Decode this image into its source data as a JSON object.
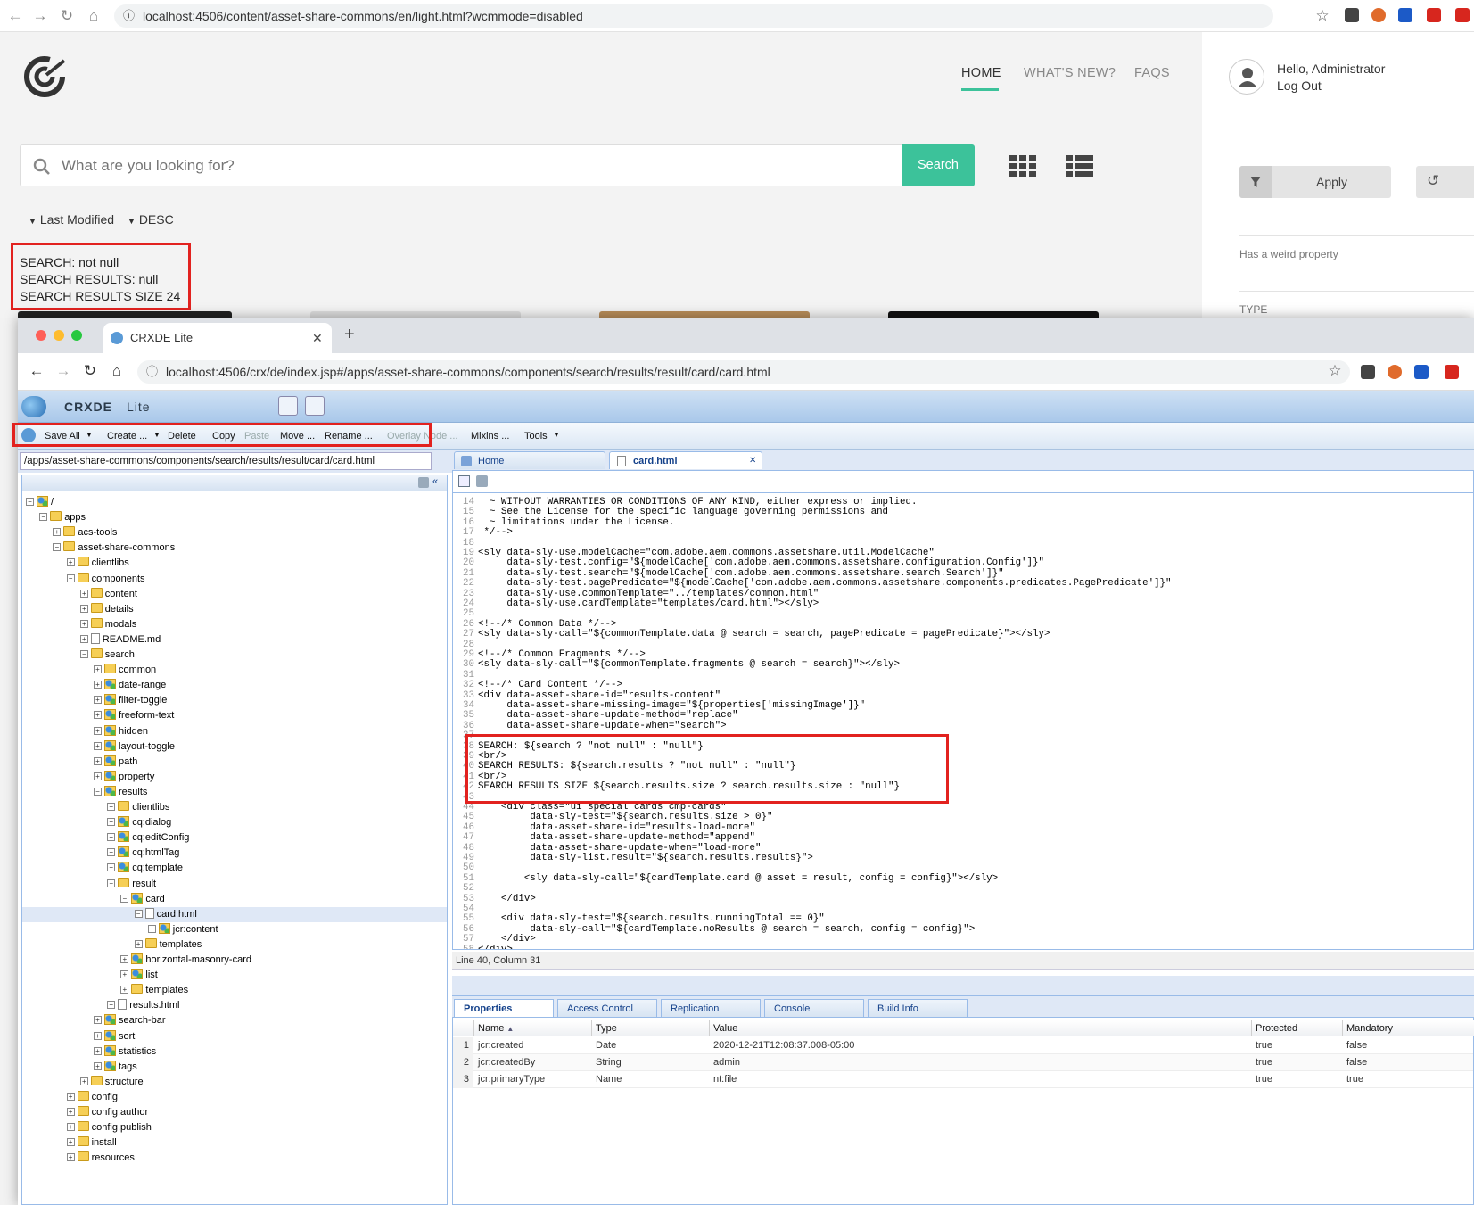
{
  "back_browser": {
    "url": "localhost:4506/content/asset-share-commons/en/light.html?wcmmode=disabled"
  },
  "asset_page": {
    "nav": [
      "HOME",
      "WHAT'S NEW?",
      "FAQS"
    ],
    "user_greeting": "Hello, Administrator",
    "logout": "Log Out",
    "search_placeholder": "What are you looking for?",
    "search_button": "Search",
    "apply_button": "Apply",
    "sort_field": "Last Modified",
    "sort_order": "DESC",
    "filter_label": "Has a weird property",
    "type_label": "TYPE",
    "debug_lines": [
      "SEARCH: not null",
      "SEARCH RESULTS: null",
      "SEARCH RESULTS SIZE 24"
    ]
  },
  "front_browser": {
    "tab_title": "CRXDE Lite",
    "url": "localhost:4506/crx/de/index.jsp#/apps/asset-share-commons/components/search/results/result/card/card.html"
  },
  "crxde": {
    "logo_main": "CRXDE",
    "logo_sub": "Lite",
    "toolbar": [
      "Save All",
      "Create ...",
      "Delete",
      "Copy",
      "Paste",
      "Move ...",
      "Rename ...",
      "Overlay Node ...",
      "Mixins ...",
      "Tools"
    ],
    "path": "/apps/asset-share-commons/components/search/results/result/card/card.html",
    "tree": [
      {
        "label": "/",
        "depth": 0,
        "icon": "comp",
        "open": true
      },
      {
        "label": "apps",
        "depth": 1,
        "icon": "folder",
        "open": true
      },
      {
        "label": "acs-tools",
        "depth": 2,
        "icon": "folder"
      },
      {
        "label": "asset-share-commons",
        "depth": 2,
        "icon": "folder",
        "open": true
      },
      {
        "label": "clientlibs",
        "depth": 3,
        "icon": "folder"
      },
      {
        "label": "components",
        "depth": 3,
        "icon": "folder",
        "open": true
      },
      {
        "label": "content",
        "depth": 4,
        "icon": "folder"
      },
      {
        "label": "details",
        "depth": 4,
        "icon": "folder"
      },
      {
        "label": "modals",
        "depth": 4,
        "icon": "folder"
      },
      {
        "label": "README.md",
        "depth": 4,
        "icon": "file"
      },
      {
        "label": "search",
        "depth": 4,
        "icon": "folder",
        "open": true
      },
      {
        "label": "common",
        "depth": 5,
        "icon": "folder"
      },
      {
        "label": "date-range",
        "depth": 5,
        "icon": "comp"
      },
      {
        "label": "filter-toggle",
        "depth": 5,
        "icon": "comp"
      },
      {
        "label": "freeform-text",
        "depth": 5,
        "icon": "comp"
      },
      {
        "label": "hidden",
        "depth": 5,
        "icon": "comp"
      },
      {
        "label": "layout-toggle",
        "depth": 5,
        "icon": "comp"
      },
      {
        "label": "path",
        "depth": 5,
        "icon": "comp"
      },
      {
        "label": "property",
        "depth": 5,
        "icon": "comp"
      },
      {
        "label": "results",
        "depth": 5,
        "icon": "comp",
        "open": true
      },
      {
        "label": "clientlibs",
        "depth": 6,
        "icon": "folder"
      },
      {
        "label": "cq:dialog",
        "depth": 6,
        "icon": "comp"
      },
      {
        "label": "cq:editConfig",
        "depth": 6,
        "icon": "comp"
      },
      {
        "label": "cq:htmlTag",
        "depth": 6,
        "icon": "comp"
      },
      {
        "label": "cq:template",
        "depth": 6,
        "icon": "comp"
      },
      {
        "label": "result",
        "depth": 6,
        "icon": "folder",
        "open": true
      },
      {
        "label": "card",
        "depth": 7,
        "icon": "comp",
        "open": true
      },
      {
        "label": "card.html",
        "depth": 8,
        "icon": "file",
        "open": true,
        "selected": true
      },
      {
        "label": "jcr:content",
        "depth": 9,
        "icon": "comp"
      },
      {
        "label": "templates",
        "depth": 8,
        "icon": "folder"
      },
      {
        "label": "horizontal-masonry-card",
        "depth": 7,
        "icon": "comp"
      },
      {
        "label": "list",
        "depth": 7,
        "icon": "comp"
      },
      {
        "label": "templates",
        "depth": 7,
        "icon": "folder"
      },
      {
        "label": "results.html",
        "depth": 6,
        "icon": "file"
      },
      {
        "label": "search-bar",
        "depth": 5,
        "icon": "comp"
      },
      {
        "label": "sort",
        "depth": 5,
        "icon": "comp"
      },
      {
        "label": "statistics",
        "depth": 5,
        "icon": "comp"
      },
      {
        "label": "tags",
        "depth": 5,
        "icon": "comp"
      },
      {
        "label": "structure",
        "depth": 4,
        "icon": "folder"
      },
      {
        "label": "config",
        "depth": 3,
        "icon": "folder"
      },
      {
        "label": "config.author",
        "depth": 3,
        "icon": "folder"
      },
      {
        "label": "config.publish",
        "depth": 3,
        "icon": "folder"
      },
      {
        "label": "install",
        "depth": 3,
        "icon": "folder"
      },
      {
        "label": "resources",
        "depth": 3,
        "icon": "folder"
      }
    ],
    "editor_tabs": [
      "Home",
      "card.html"
    ],
    "code": [
      {
        "n": "14",
        "t": "  ~ WITHOUT WARRANTIES OR CONDITIONS OF ANY KIND, either express or implied."
      },
      {
        "n": "15",
        "t": "  ~ See the License for the specific language governing permissions and"
      },
      {
        "n": "16",
        "t": "  ~ limitations under the License."
      },
      {
        "n": "17",
        "t": " */-->"
      },
      {
        "n": "18",
        "t": ""
      },
      {
        "n": "19",
        "t": "<sly data-sly-use.modelCache=\"com.adobe.aem.commons.assetshare.util.ModelCache\""
      },
      {
        "n": "20",
        "t": "     data-sly-test.config=\"${modelCache['com.adobe.aem.commons.assetshare.configuration.Config']}\""
      },
      {
        "n": "21",
        "t": "     data-sly-test.search=\"${modelCache['com.adobe.aem.commons.assetshare.search.Search']}\""
      },
      {
        "n": "22",
        "t": "     data-sly-test.pagePredicate=\"${modelCache['com.adobe.aem.commons.assetshare.components.predicates.PagePredicate']}\""
      },
      {
        "n": "23",
        "t": "     data-sly-use.commonTemplate=\"../templates/common.html\""
      },
      {
        "n": "24",
        "t": "     data-sly-use.cardTemplate=\"templates/card.html\"></sly>"
      },
      {
        "n": "25",
        "t": ""
      },
      {
        "n": "26",
        "t": "<!--/* Common Data */-->"
      },
      {
        "n": "27",
        "t": "<sly data-sly-call=\"${commonTemplate.data @ search = search, pagePredicate = pagePredicate}\"></sly>"
      },
      {
        "n": "28",
        "t": ""
      },
      {
        "n": "29",
        "t": "<!--/* Common Fragments */-->"
      },
      {
        "n": "30",
        "t": "<sly data-sly-call=\"${commonTemplate.fragments @ search = search}\"></sly>"
      },
      {
        "n": "31",
        "t": ""
      },
      {
        "n": "32",
        "t": "<!--/* Card Content */-->"
      },
      {
        "n": "33",
        "t": "<div data-asset-share-id=\"results-content\""
      },
      {
        "n": "34",
        "t": "     data-asset-share-missing-image=\"${properties['missingImage']}\""
      },
      {
        "n": "35",
        "t": "     data-asset-share-update-method=\"replace\""
      },
      {
        "n": "36",
        "t": "     data-asset-share-update-when=\"search\">"
      },
      {
        "n": "37",
        "t": ""
      },
      {
        "n": "38",
        "t": "SEARCH: ${search ? \"not null\" : \"null\"}"
      },
      {
        "n": "39",
        "t": "<br/>"
      },
      {
        "n": "40",
        "t": "SEARCH RESULTS: ${search.results ? \"not null\" : \"null\"}"
      },
      {
        "n": "41",
        "t": "<br/>"
      },
      {
        "n": "42",
        "t": "SEARCH RESULTS SIZE ${search.results.size ? search.results.size : \"null\"}"
      },
      {
        "n": "43",
        "t": ""
      },
      {
        "n": "44",
        "t": "    <div class=\"ui special cards cmp-cards\""
      },
      {
        "n": "45",
        "t": "         data-sly-test=\"${search.results.size > 0}\""
      },
      {
        "n": "46",
        "t": "         data-asset-share-id=\"results-load-more\""
      },
      {
        "n": "47",
        "t": "         data-asset-share-update-method=\"append\""
      },
      {
        "n": "48",
        "t": "         data-asset-share-update-when=\"load-more\""
      },
      {
        "n": "49",
        "t": "         data-sly-list.result=\"${search.results.results}\">"
      },
      {
        "n": "50",
        "t": ""
      },
      {
        "n": "51",
        "t": "        <sly data-sly-call=\"${cardTemplate.card @ asset = result, config = config}\"></sly>"
      },
      {
        "n": "52",
        "t": ""
      },
      {
        "n": "53",
        "t": "    </div>"
      },
      {
        "n": "54",
        "t": ""
      },
      {
        "n": "55",
        "t": "    <div data-sly-test=\"${search.results.runningTotal == 0}\""
      },
      {
        "n": "56",
        "t": "         data-sly-call=\"${cardTemplate.noResults @ search = search, config = config}\">"
      },
      {
        "n": "57",
        "t": "    </div>"
      },
      {
        "n": "58",
        "t": "</div>"
      }
    ],
    "status": "Line 40, Column 31",
    "bottom_tabs": [
      "Properties",
      "Access Control",
      "Replication",
      "Console",
      "Build Info"
    ],
    "props_headers": [
      "Name",
      "Type",
      "Value",
      "Protected",
      "Mandatory"
    ],
    "props_rows": [
      [
        "1",
        "jcr:created",
        "Date",
        "2020-12-21T12:08:37.008-05:00",
        "true",
        "false"
      ],
      [
        "2",
        "jcr:createdBy",
        "String",
        "admin",
        "true",
        "false"
      ],
      [
        "3",
        "jcr:primaryType",
        "Name",
        "nt:file",
        "true",
        "true"
      ]
    ]
  },
  "colors": {
    "accent": "#3cc29a",
    "highlight": "#e2221f",
    "crx_blue": "#99bbe8"
  }
}
